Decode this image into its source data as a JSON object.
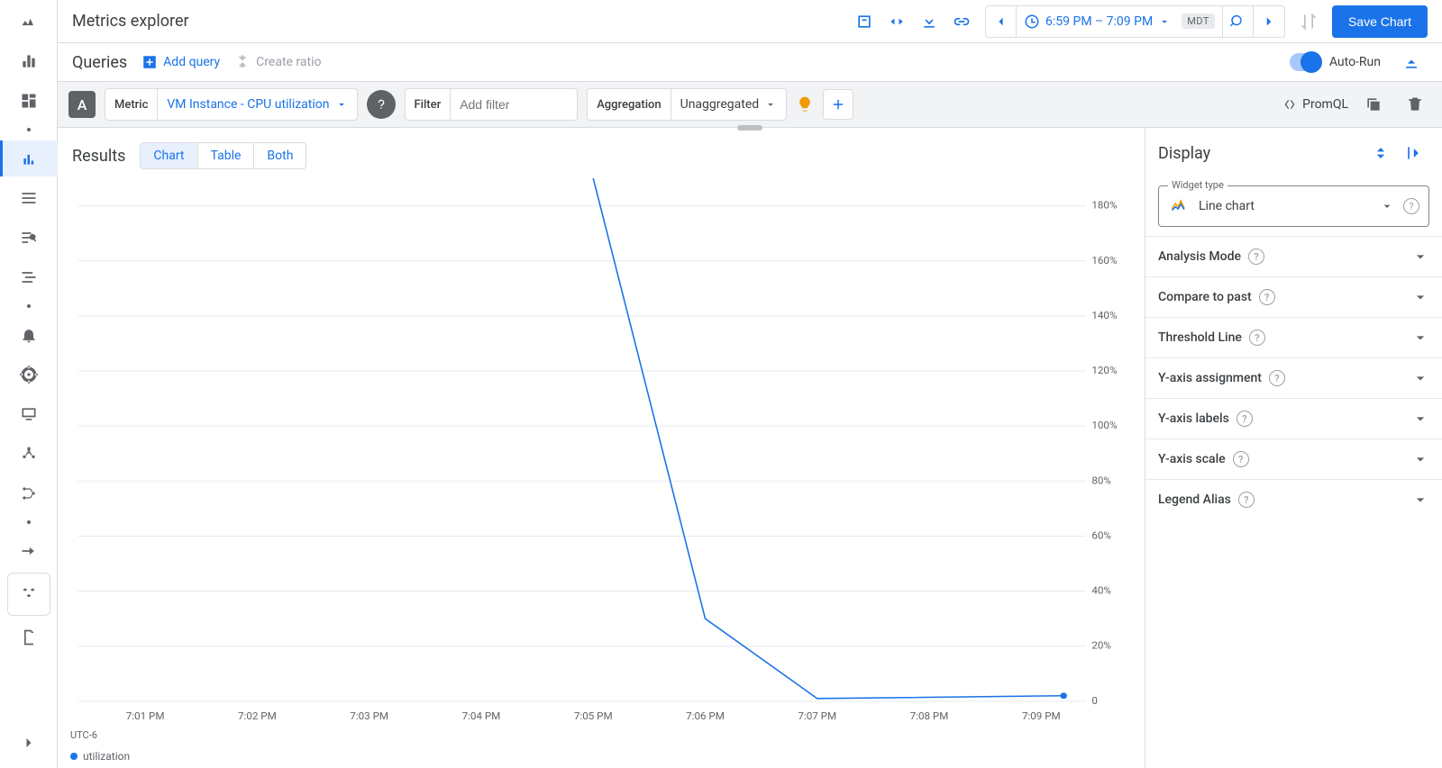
{
  "header": {
    "title": "Metrics explorer",
    "time_range": "6:59 PM – 7:09 PM",
    "timezone": "MDT",
    "save_label": "Save Chart"
  },
  "queries_bar": {
    "title": "Queries",
    "add_query": "Add query",
    "create_ratio": "Create ratio",
    "auto_run": "Auto-Run"
  },
  "builder": {
    "chip": "A",
    "metric_label": "Metric",
    "metric_value": "VM Instance - CPU utilization",
    "filter_label": "Filter",
    "filter_placeholder": "Add filter",
    "aggregation_label": "Aggregation",
    "aggregation_value": "Unaggregated",
    "promql": "PromQL"
  },
  "results": {
    "title": "Results",
    "tabs": {
      "chart": "Chart",
      "table": "Table",
      "both": "Both"
    },
    "timezone_label": "UTC-6",
    "legend_label": "utilization"
  },
  "display": {
    "title": "Display",
    "widget_type_label": "Widget type",
    "widget_type_value": "Line chart",
    "sections": {
      "analysis_mode": "Analysis Mode",
      "compare_past": "Compare to past",
      "threshold": "Threshold Line",
      "y_assign": "Y-axis assignment",
      "y_labels": "Y-axis labels",
      "y_scale": "Y-axis scale",
      "legend_alias": "Legend Alias"
    }
  },
  "chart_data": {
    "type": "line",
    "title": "",
    "xlabel": "",
    "ylabel": "",
    "x_ticks": [
      "7:01 PM",
      "7:02 PM",
      "7:03 PM",
      "7:04 PM",
      "7:05 PM",
      "7:06 PM",
      "7:07 PM",
      "7:08 PM",
      "7:09 PM"
    ],
    "y_ticks_pct": [
      0,
      20,
      40,
      60,
      80,
      100,
      120,
      140,
      160,
      180
    ],
    "ylim": [
      0,
      190
    ],
    "series": [
      {
        "name": "utilization",
        "points": [
          {
            "x": "7:05 PM",
            "x_minute": 5.0,
            "y_pct": 190
          },
          {
            "x": "7:06 PM",
            "x_minute": 6.0,
            "y_pct": 30
          },
          {
            "x": "7:07 PM",
            "x_minute": 7.0,
            "y_pct": 1
          },
          {
            "x": "7:09 PM",
            "x_minute": 9.2,
            "y_pct": 2
          }
        ]
      }
    ]
  }
}
